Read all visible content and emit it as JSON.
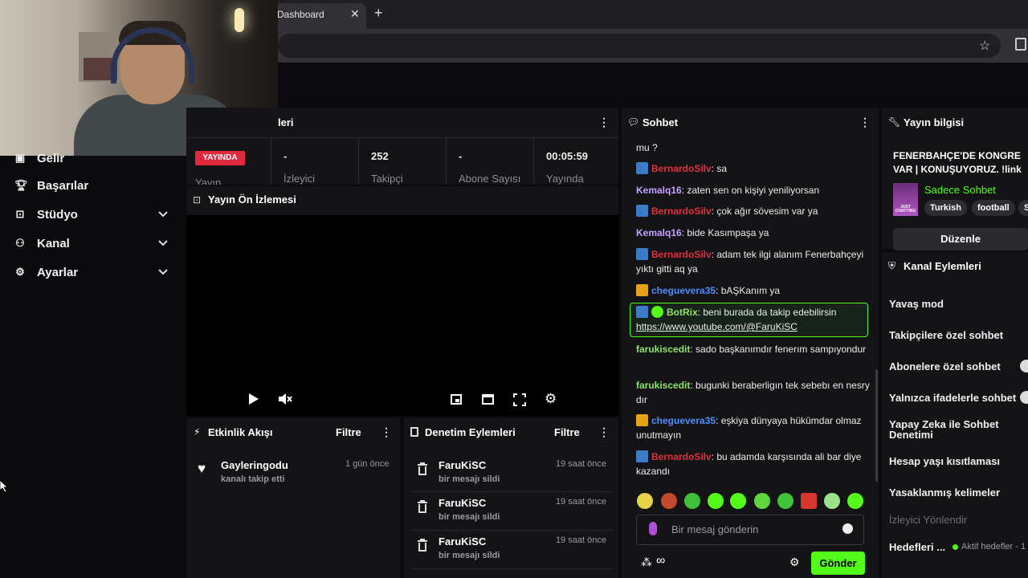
{
  "browser": {
    "tab_title": "Dashboard",
    "tab_close": "✕",
    "new_tab": "+"
  },
  "sidebar": {
    "items": [
      {
        "label": "Gelir",
        "icon": "wallet-icon"
      },
      {
        "label": "Başarılar",
        "icon": "trophy-icon"
      },
      {
        "label": "Stüdyo",
        "icon": "studio-icon"
      },
      {
        "label": "Kanal",
        "icon": "users-icon"
      },
      {
        "label": "Ayarlar",
        "icon": "gear-icon"
      }
    ]
  },
  "stats": {
    "header_title_fragment": "leri",
    "live_badge": "YAYINDA",
    "stream_label": "Yayın",
    "items": [
      {
        "value": "-",
        "label": "İzleyici"
      },
      {
        "value": "252",
        "label": "Takipçi"
      },
      {
        "value": "-",
        "label": "Abone Sayısı"
      },
      {
        "value": "00:05:59",
        "label": "Yayında"
      }
    ]
  },
  "preview": {
    "title": "Yayın Ön İzlemesi"
  },
  "activity": {
    "title": "Etkinlik Akışı",
    "filter": "Filtre",
    "items": [
      {
        "user": "Gayleringodu",
        "action": "kanalı takip etti",
        "time": "1 gün önce"
      }
    ]
  },
  "moderation": {
    "title": "Denetim Eylemleri",
    "filter": "Filtre",
    "items": [
      {
        "user": "FaruKiSC",
        "action": "bir mesajı sildi",
        "time": "19 saat önce"
      },
      {
        "user": "FaruKiSC",
        "action": "bir mesajı sildi",
        "time": "19 saat önce"
      },
      {
        "user": "FaruKiSC",
        "action": "bir mesajı sildi",
        "time": "19 saat önce"
      }
    ]
  },
  "chat": {
    "title": "Sohbet",
    "top_fragment": "mu ?",
    "messages": [
      {
        "user": "BernardoSilv",
        "text": "sa"
      },
      {
        "user": "Kemalq16",
        "text": "zaten sen on kişiyi yeniliyorsan"
      },
      {
        "user": "BernardoSilv",
        "text": "çok ağır sövesim var ya"
      },
      {
        "user": "Kemalq16",
        "text": "bide Kasımpaşa ya"
      },
      {
        "user": "BernardoSilv",
        "text": "adam tek ilgi alanım Fenerbahçeyi yıktı gitti aq ya"
      },
      {
        "user": "cheguevera35",
        "text": "bAŞKanım ya"
      },
      {
        "user": "BotRix",
        "text": "beni burada da takip edebilirsin",
        "link": "https://www.youtube.com/@FaruKiSC"
      },
      {
        "user": "farukiscedit",
        "text": "sado başkanımdır fenerım sampıyondur"
      },
      {
        "user": "farukiscedit",
        "text": "bugunki beraberligın tek sebebı en nesry dır"
      },
      {
        "user": "cheguevera35",
        "text": "eşkiya dünyaya hükümdar olmaz unutmayın"
      },
      {
        "user": "BernardoSilv",
        "text": "bu adamda karşısında ali bar diye kazandı"
      }
    ],
    "input_placeholder": "Bir mesaj gönderin",
    "send_button": "Gönder"
  },
  "stream_info": {
    "title": "Yayın bilgisi",
    "stream_title": "FENERBAHÇE'DE KONGRE VAR | KONUŞUYORUZ. !link",
    "category": "Sadece Sohbet",
    "category_thumb": "JUST CHATTING",
    "tags": [
      "Turkish",
      "football",
      "S"
    ],
    "edit_button": "Düzenle"
  },
  "channel_actions": {
    "title": "Kanal Eylemleri",
    "items": [
      {
        "label": "Yavaş mod",
        "toggle": false
      },
      {
        "label": "Takipçilere özel sohbet",
        "toggle": false
      },
      {
        "label": "Abonelere özel sohbet",
        "toggle": true
      },
      {
        "label": "Yalnızca ifadelerle sohbet",
        "toggle": true
      },
      {
        "label": "Yapay Zeka ile Sohbet Denetimi",
        "toggle": false
      },
      {
        "label": "Hesap yaşı kısıtlaması",
        "toggle": false
      },
      {
        "label": "Yasaklanmış kelimeler",
        "toggle": false
      }
    ],
    "viewer_redirect": "İzleyici Yönlendir",
    "goals_label": "Hedefleri ...",
    "goals_status": "Aktif hedefler - 1"
  },
  "colors": {
    "accent_green": "#53fc18",
    "live_red": "#e0283e"
  }
}
